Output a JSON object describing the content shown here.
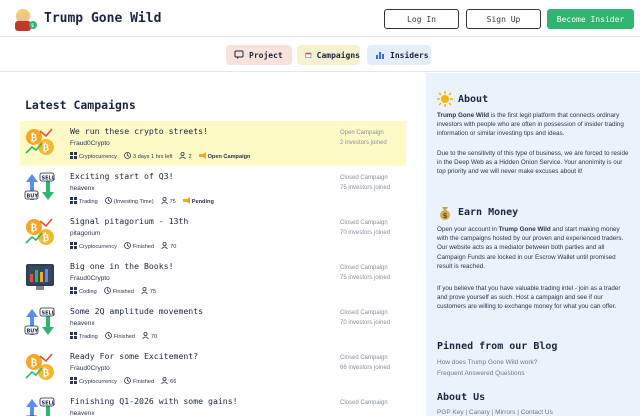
{
  "header": {
    "brand": "Trump Gone Wild",
    "login": "Log In",
    "signup": "Sign Up",
    "become_insider": "Become Insider"
  },
  "nav": {
    "project": "Project",
    "campaigns": "Campaigns",
    "insiders": "Insiders"
  },
  "main": {
    "title": "Latest Campaigns",
    "campaigns": [
      {
        "title": "We run these crypto streets!",
        "author": "Fraud0Crypto",
        "category": "Cryptocurrency",
        "time": "3 days 1 hrs left",
        "count": "2",
        "tag": "Open Campaign",
        "status": "Open Campaign",
        "joined": "2 investors joined",
        "icon": "crypto-coins-icon"
      },
      {
        "title": "Exciting start of Q3!",
        "author": "heavenx",
        "category": "Trading",
        "time": "(Investing Time)",
        "count": "75",
        "tag": "Pending",
        "status": "Closed Campaign",
        "joined": "75 investors joined",
        "icon": "buy-sell-icon"
      },
      {
        "title": "Signal pitagorium - 13th",
        "author": "pitagorium",
        "category": "Cryptocurrency",
        "time": "Finished",
        "count": "70",
        "tag": "",
        "status": "Closed Campaign",
        "joined": "70 investors joined",
        "icon": "crypto-coins-icon"
      },
      {
        "title": "Big one in the Books!",
        "author": "Fraud0Crypto",
        "category": "Coding",
        "time": "Finished",
        "count": "75",
        "tag": "",
        "status": "Closed Campaign",
        "joined": "75 investors joined",
        "icon": "chart-screen-icon"
      },
      {
        "title": "Some 2Q amplitude movements",
        "author": "heavenx",
        "category": "Trading",
        "time": "Finished",
        "count": "70",
        "tag": "",
        "status": "Closed Campaign",
        "joined": "70 investors joined",
        "icon": "buy-sell-icon"
      },
      {
        "title": "Ready For some Excitement?",
        "author": "Fraud0Crypto",
        "category": "Cryptocurrency",
        "time": "Finished",
        "count": "66",
        "tag": "",
        "status": "Closed Campaign",
        "joined": "66 investors joined",
        "icon": "crypto-coins-icon"
      },
      {
        "title": "Finishing Q1-2026 with some gains!",
        "author": "heavenx",
        "category": "",
        "time": "",
        "count": "",
        "tag": "",
        "status": "Closed Campaign",
        "joined": "",
        "icon": "buy-sell-icon"
      }
    ]
  },
  "sidebar": {
    "about_title": "About",
    "about_p1_bold": "Trump Gone Wild",
    "about_p1_rest": " is the first legit platform that connects ordinary investors with people who are often in possession of insider trading information or similar investing tips and ideas.",
    "about_p2": "Due to the sensitivity of this type of business, we are forced to reside in the Deep Web as a Hidden Onion Service. Your anonimity is our top priority and we will never make excuses about it!",
    "earn_title": "Earn Money",
    "earn_p1_a": "Open your account in ",
    "earn_p1_bold": "Trump Gone Wild",
    "earn_p1_b": " and start making money with the campaigns hosted by our proven and experienced traders. Our website acts as a mediator between both parties and all Campaign Funds are locked in our Escrow Wallet until promised result is reached.",
    "earn_p2": "If you believe that you have valuable trading intel - join as a trader and prove yourself as such. Host a campaign and see if our customers are willing to exchange money for what you can offer.",
    "blog_title": "Pinned from our Blog",
    "blog_link1": "How does Trump Gone Wild work?",
    "blog_link2": "Frequent Answered Questions",
    "aboutus_title": "About Us",
    "aboutus_links": "PGP Key | Canary | Mirrors | Contact Us"
  }
}
